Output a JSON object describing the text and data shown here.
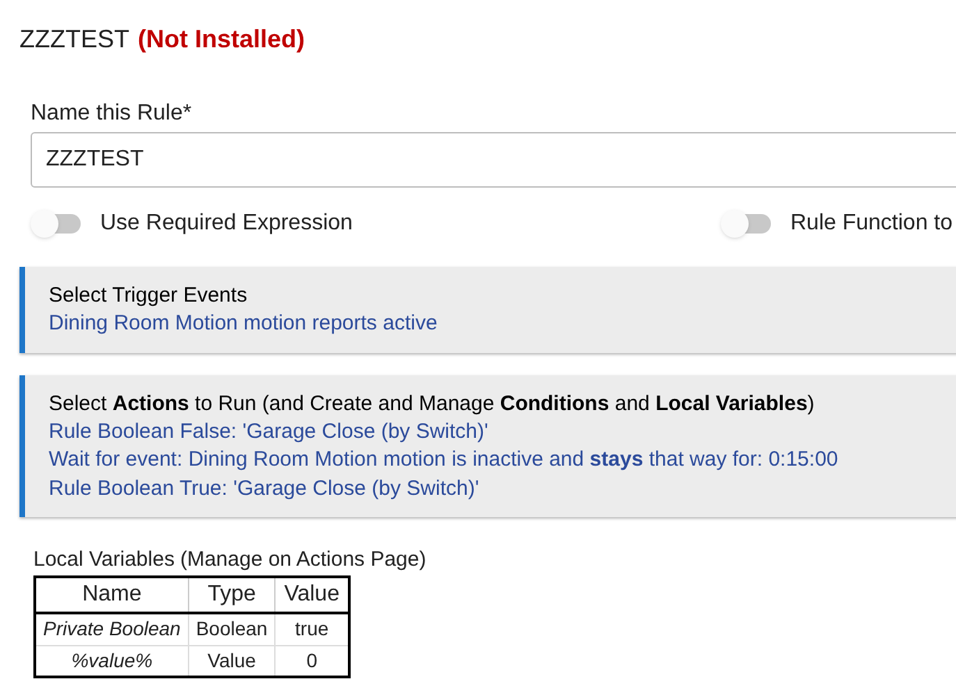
{
  "title": {
    "name": "ZZZTEST",
    "status": "(Not Installed)"
  },
  "name_field": {
    "label": "Name this Rule*",
    "value": "ZZZTEST"
  },
  "toggles": [
    {
      "label": "Use Required Expression",
      "on": false
    },
    {
      "label": "Rule Function to",
      "on": false
    }
  ],
  "sections": [
    {
      "heading": "Select Trigger Events",
      "lines": [
        "Dining Room Motion motion reports active"
      ]
    },
    {
      "heading": "Select **Actions** to Run (and Create and Manage **Conditions** and **Local Variables**)",
      "lines": [
        "Rule Boolean False: 'Garage Close (by Switch)'",
        "Wait for event: Dining Room Motion motion is inactive and **stays** that way for: 0:15:00",
        "Rule Boolean True: 'Garage Close (by Switch)'"
      ]
    }
  ],
  "local_variables": {
    "title": "Local Variables",
    "note": "(Manage on Actions Page)",
    "columns": [
      "Name",
      "Type",
      "Value"
    ],
    "rows": [
      [
        "Private Boolean",
        "Boolean",
        "true"
      ],
      [
        "%value%",
        "Value",
        "0"
      ]
    ]
  }
}
